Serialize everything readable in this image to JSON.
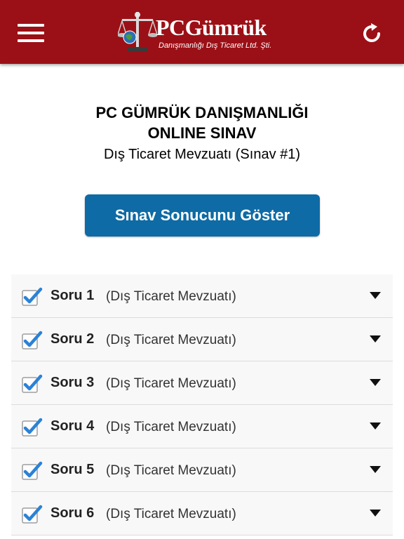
{
  "header": {
    "logo_title": "PCGümrük",
    "logo_subtitle": "Danışmanlığı Dış Ticaret Ltd. Şti.",
    "bar_color": "#9b1016"
  },
  "main": {
    "title_line1": "PC GÜMRÜK DANIŞMANLIĞI",
    "title_line2": "ONLINE SINAV",
    "subtitle": "Dış Ticaret Mevzuatı (Sınav #1)",
    "result_button_label": "Sınav Sonucunu Göster",
    "button_color": "#0e6ba5"
  },
  "questions": [
    {
      "label": "Soru 1",
      "category": "(Dış Ticaret Mevzuatı)",
      "checked": true
    },
    {
      "label": "Soru 2",
      "category": "(Dış Ticaret Mevzuatı)",
      "checked": true
    },
    {
      "label": "Soru 3",
      "category": "(Dış Ticaret Mevzuatı)",
      "checked": true
    },
    {
      "label": "Soru 4",
      "category": "(Dış Ticaret Mevzuatı)",
      "checked": true
    },
    {
      "label": "Soru 5",
      "category": "(Dış Ticaret Mevzuatı)",
      "checked": true
    },
    {
      "label": "Soru 6",
      "category": "(Dış Ticaret Mevzuatı)",
      "checked": true
    }
  ],
  "icons": {
    "menu": "hamburger-menu-icon",
    "refresh": "refresh-icon",
    "check": "checkbox-checked-icon",
    "expand": "triangle-down-icon"
  }
}
